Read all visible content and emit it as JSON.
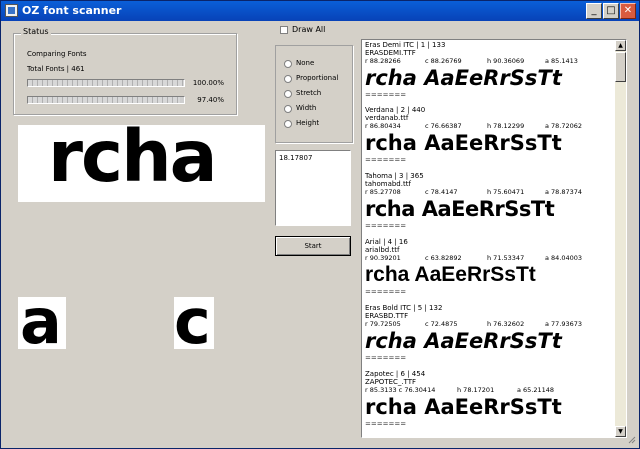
{
  "window": {
    "title": "OZ font scanner",
    "minimize": "_",
    "maximize": "□",
    "close": "✕"
  },
  "status": {
    "group_title": "Status",
    "comparing": "Comparing Fonts",
    "total": "Total Fonts | 461",
    "progress1": {
      "value": 100,
      "label": "100.00%"
    },
    "progress2": {
      "value": 97.4,
      "label": "97.40%"
    }
  },
  "preview": {
    "text": "rcha",
    "glyph1": "a",
    "glyph2": "c"
  },
  "controls": {
    "draw_all": "Draw All",
    "modes": [
      "None",
      "Proportional",
      "Stretch",
      "Width",
      "Height"
    ],
    "output": "18.17807",
    "start": "Start"
  },
  "results": {
    "separator": "=======",
    "sample": "rcha AaEeRrSsTt",
    "entries": [
      {
        "title": "Eras Demi ITC | 1 | 133",
        "file": "ERASDEMI.TTF",
        "r": "r 88.28266",
        "c": "c 88.26769",
        "h": "h 90.36069",
        "a": "a 85.1413"
      },
      {
        "title": "Verdana | 2 | 440",
        "file": "verdanab.ttf",
        "r": "r 86.80434",
        "c": "c 76.66387",
        "h": "h 78.12299",
        "a": "a 78.72062"
      },
      {
        "title": "Tahoma | 3 | 365",
        "file": "tahomabd.ttf",
        "r": "r 85.27708",
        "c": "c 78.4147",
        "h": "h 75.60471",
        "a": "a 78.87374"
      },
      {
        "title": "Arial | 4 | 16",
        "file": "arialbd.ttf",
        "r": "r 90.39201",
        "c": "c 63.82892",
        "h": "h 71.53347",
        "a": "a 84.04003"
      },
      {
        "title": "Eras Bold ITC | 5 | 132",
        "file": "ERASBD.TTF",
        "r": "r 79.72505",
        "c": "c 72.4875",
        "h": "h 76.32602",
        "a": "a 77.93673"
      },
      {
        "title": "Zapotec | 6 | 454",
        "file": "ZAPOTEC_.TTF",
        "r": "r 85.3133 c 76.30414",
        "c": "",
        "h": "h 78.17201",
        "a": "a 65.21148"
      }
    ]
  }
}
